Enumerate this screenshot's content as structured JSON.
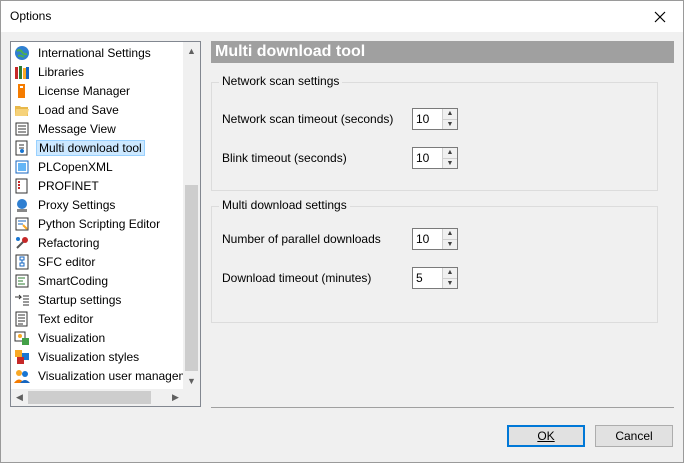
{
  "window": {
    "title": "Options"
  },
  "tree": {
    "items": [
      {
        "label": "International Settings",
        "icon": "globe-icon"
      },
      {
        "label": "Libraries",
        "icon": "books-icon"
      },
      {
        "label": "License Manager",
        "icon": "license-icon"
      },
      {
        "label": "Load and Save",
        "icon": "folder-icon"
      },
      {
        "label": "Message View",
        "icon": "message-view-icon"
      },
      {
        "label": "Multi download tool",
        "icon": "multi-download-icon",
        "selected": true
      },
      {
        "label": "PLCopenXML",
        "icon": "xml-icon"
      },
      {
        "label": "PROFINET",
        "icon": "profinet-icon"
      },
      {
        "label": "Proxy Settings",
        "icon": "proxy-icon"
      },
      {
        "label": "Python Scripting Editor",
        "icon": "python-icon"
      },
      {
        "label": "Refactoring",
        "icon": "refactoring-icon"
      },
      {
        "label": "SFC editor",
        "icon": "sfc-icon"
      },
      {
        "label": "SmartCoding",
        "icon": "smartcoding-icon"
      },
      {
        "label": "Startup settings",
        "icon": "startup-icon"
      },
      {
        "label": "Text editor",
        "icon": "text-editor-icon"
      },
      {
        "label": "Visualization",
        "icon": "visualization-icon"
      },
      {
        "label": "Visualization styles",
        "icon": "visualization-styles-icon"
      },
      {
        "label": "Visualization user management",
        "icon": "users-icon"
      }
    ]
  },
  "page": {
    "title": "Multi download tool",
    "network_group": {
      "title": "Network scan settings",
      "scan_timeout_label": "Network scan timeout (seconds)",
      "scan_timeout_value": "10",
      "blink_timeout_label": "Blink timeout (seconds)",
      "blink_timeout_value": "10"
    },
    "download_group": {
      "title": "Multi download settings",
      "parallel_label": "Number of parallel downloads",
      "parallel_value": "10",
      "timeout_label": "Download timeout (minutes)",
      "timeout_value": "5"
    }
  },
  "buttons": {
    "ok_label": "OK",
    "cancel_label": "Cancel"
  },
  "colors": {
    "header_bg": "#a0a0a0",
    "selection_bg": "#cce8ff",
    "default_button_border": "#0078d7"
  }
}
